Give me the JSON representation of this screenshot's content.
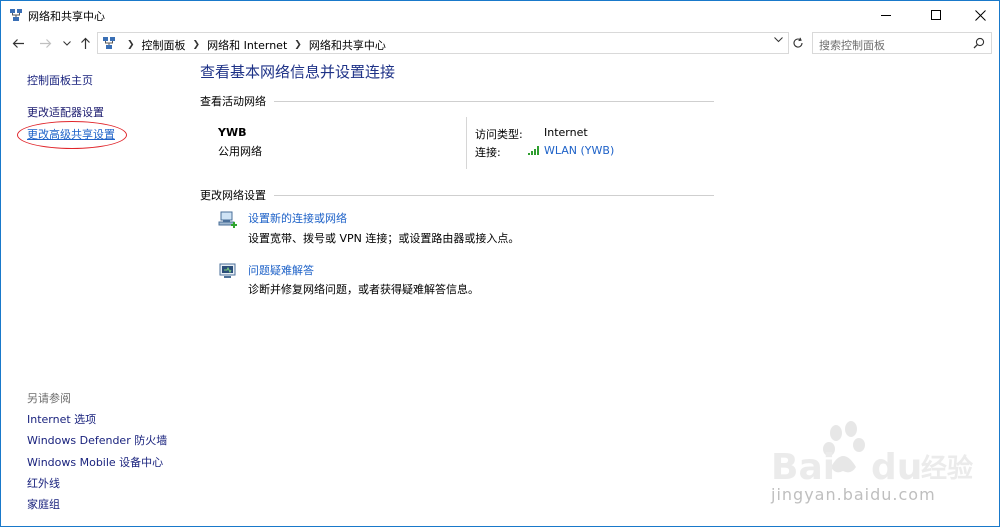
{
  "window": {
    "title": "网络和共享中心"
  },
  "nav": {
    "breadcrumbs": [
      "控制面板",
      "网络和 Internet",
      "网络和共享中心"
    ],
    "search_placeholder": "搜索控制面板"
  },
  "sidebar": {
    "home": "控制面板主页",
    "adapter": "更改适配器设置",
    "advanced": "更改高级共享设置",
    "see_also_title": "另请参阅",
    "see_also": [
      "Internet 选项",
      "Windows Defender 防火墙",
      "Windows Mobile 设备中心",
      "红外线",
      "家庭组"
    ]
  },
  "main": {
    "title": "查看基本网络信息并设置连接",
    "active_header": "查看活动网络",
    "network": {
      "name": "YWB",
      "type": "公用网络",
      "access_label": "访问类型:",
      "access_value": "Internet",
      "conn_label": "连接:",
      "conn_value": "WLAN (YWB)"
    },
    "change_header": "更改网络设置",
    "tasks": [
      {
        "link": "设置新的连接或网络",
        "desc": "设置宽带、拨号或 VPN 连接；或设置路由器或接入点。"
      },
      {
        "link": "问题疑难解答",
        "desc": "诊断并修复网络问题，或者获得疑难解答信息。"
      }
    ]
  },
  "watermark": {
    "brand": "Baidu 经验",
    "url": "jingyan.baidu.com"
  },
  "colors": {
    "link": "#1e62c8",
    "title": "#1e3287",
    "annotation": "#e0252b"
  }
}
